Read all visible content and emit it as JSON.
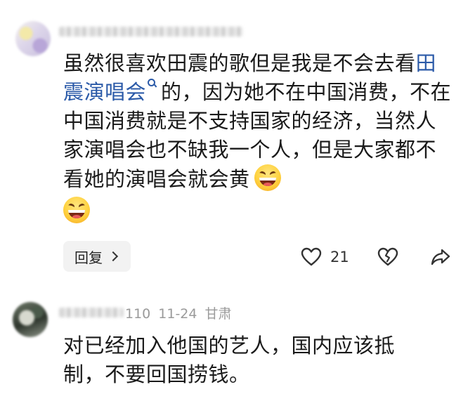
{
  "comments": [
    {
      "text_before_link": "虽然很喜欢田震的歌但是我是不会去看",
      "link_text": "田震演唱会",
      "text_after_link": "的，因为她不在中国消费，不在中国消费就是不支持国家的经济，当然人家演唱会也不缺我一个人，但是大家都不看她的演唱会就会黄",
      "emojis": [
        "laughing-emoji",
        "laughing-emoji"
      ],
      "reply_label": "回复",
      "like_count": "21"
    },
    {
      "username_visible": "110",
      "date": "11-24",
      "location": "甘肃",
      "text": "对已经加入他国的艺人，国内应该抵制，不要回国捞钱。"
    }
  ],
  "colors": {
    "link": "#2b5aa8",
    "meta": "#9a9a9a",
    "text": "#1a1a1a"
  },
  "icons": [
    "heart-icon",
    "broken-heart-icon",
    "share-icon",
    "search-icon",
    "chevron-right-icon"
  ]
}
